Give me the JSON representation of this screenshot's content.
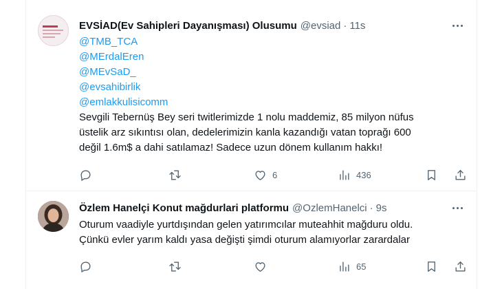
{
  "tweets": [
    {
      "author_name": "EVSİAD(Ev Sahipleri Dayanışması) Olusumu",
      "handle": "@evsiad",
      "separator": "·",
      "time": "11s",
      "mentions": [
        "@TMB_TCA",
        "@MErdalEren",
        "@MEvSaD_",
        "@evsahibirlik",
        "@emlakkulisicomm"
      ],
      "text_lines": [
        "Sevgili Tebernüş Bey seri twitlerimizde 1 nolu maddemiz, 85  milyon nüfus",
        "üstelik arz sıkıntısı olan, dedelerimizin kanla kazandığı vatan toprağı 600",
        "değil 1.6m$ a dahi satılamaz! Sadece uzun dönem kullanım hakkı!"
      ],
      "replies": "",
      "retweets": "",
      "likes": "6",
      "views": "436"
    },
    {
      "author_name": "Özlem Hanelçi Konut mağdurlari platformu",
      "handle": "@OzlemHanelci",
      "separator": "·",
      "time": "9s",
      "text_lines": [
        "Oturum vaadiyle yurtdışından gelen yatırımcılar muteahhit mağduru oldu.",
        "Çünkü evler yarım kaldı yasa değişti şimdi oturum alamıyorlar zarardalar"
      ],
      "replies": "",
      "retweets": "",
      "likes": "",
      "views": "65"
    }
  ],
  "icons": {
    "reply": "reply-icon",
    "retweet": "retweet-icon",
    "like": "heart-icon",
    "views": "views-bar-chart-icon",
    "bookmark": "bookmark-icon",
    "share": "share-upload-icon",
    "more": "more-dots-icon"
  },
  "colors": {
    "link": "#1d9bf0",
    "secondary_text": "#536471",
    "primary_text": "#0f1419",
    "divider": "#eff3f4"
  }
}
